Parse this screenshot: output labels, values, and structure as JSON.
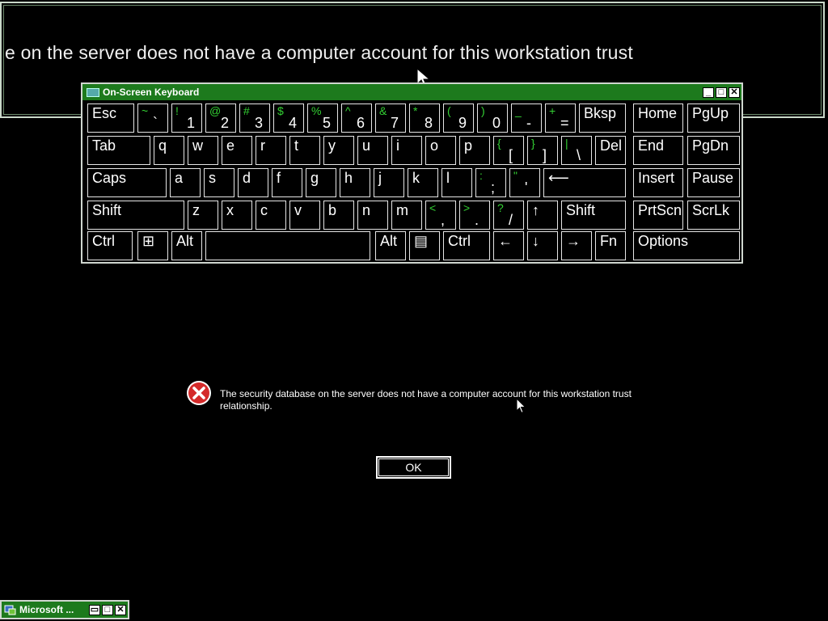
{
  "magnifier": {
    "text": "e on the server does not have a computer account for this workstation trust"
  },
  "osk": {
    "title": "On-Screen Keyboard",
    "controls": {
      "minimize": "_",
      "maximize": "□",
      "close": "✕"
    },
    "keys": [
      {
        "id": "esc",
        "label": "Esc"
      },
      {
        "id": "grave",
        "shift": "~",
        "base": "`"
      },
      {
        "id": "1",
        "shift": "!",
        "base": "1"
      },
      {
        "id": "2",
        "shift": "@",
        "base": "2"
      },
      {
        "id": "3",
        "shift": "#",
        "base": "3"
      },
      {
        "id": "4",
        "shift": "$",
        "base": "4"
      },
      {
        "id": "5",
        "shift": "%",
        "base": "5"
      },
      {
        "id": "6",
        "shift": "^",
        "base": "6"
      },
      {
        "id": "7",
        "shift": "&",
        "base": "7"
      },
      {
        "id": "8",
        "shift": "*",
        "base": "8"
      },
      {
        "id": "9",
        "shift": "(",
        "base": "9"
      },
      {
        "id": "0",
        "shift": ")",
        "base": "0"
      },
      {
        "id": "minus",
        "shift": "_",
        "base": "-"
      },
      {
        "id": "equals",
        "shift": "+",
        "base": "="
      },
      {
        "id": "bksp",
        "label": "Bksp"
      },
      {
        "id": "home",
        "label": "Home"
      },
      {
        "id": "pgup",
        "label": "PgUp"
      },
      {
        "id": "tab",
        "label": "Tab"
      },
      {
        "id": "q",
        "label": "q"
      },
      {
        "id": "w",
        "label": "w"
      },
      {
        "id": "e",
        "label": "e"
      },
      {
        "id": "r",
        "label": "r"
      },
      {
        "id": "t",
        "label": "t"
      },
      {
        "id": "y",
        "label": "y"
      },
      {
        "id": "u",
        "label": "u"
      },
      {
        "id": "i",
        "label": "i"
      },
      {
        "id": "o",
        "label": "o"
      },
      {
        "id": "p",
        "label": "p"
      },
      {
        "id": "lbracket",
        "shift": "{",
        "base": "["
      },
      {
        "id": "rbracket",
        "shift": "}",
        "base": "]"
      },
      {
        "id": "backslash",
        "shift": "|",
        "base": "\\"
      },
      {
        "id": "del",
        "label": "Del"
      },
      {
        "id": "end",
        "label": "End"
      },
      {
        "id": "pgdn",
        "label": "PgDn"
      },
      {
        "id": "caps",
        "label": "Caps"
      },
      {
        "id": "a",
        "label": "a"
      },
      {
        "id": "s",
        "label": "s"
      },
      {
        "id": "d",
        "label": "d"
      },
      {
        "id": "f",
        "label": "f"
      },
      {
        "id": "g",
        "label": "g"
      },
      {
        "id": "h",
        "label": "h"
      },
      {
        "id": "j",
        "label": "j"
      },
      {
        "id": "k",
        "label": "k"
      },
      {
        "id": "l",
        "label": "l"
      },
      {
        "id": "semicolon",
        "shift": ":",
        "base": ";"
      },
      {
        "id": "quote",
        "shift": "\"",
        "base": "'"
      },
      {
        "id": "enter",
        "label": "⟵"
      },
      {
        "id": "insert",
        "label": "Insert"
      },
      {
        "id": "pause",
        "label": "Pause"
      },
      {
        "id": "lshift",
        "label": "Shift"
      },
      {
        "id": "z",
        "label": "z"
      },
      {
        "id": "x",
        "label": "x"
      },
      {
        "id": "c",
        "label": "c"
      },
      {
        "id": "v",
        "label": "v"
      },
      {
        "id": "b",
        "label": "b"
      },
      {
        "id": "n",
        "label": "n"
      },
      {
        "id": "m",
        "label": "m"
      },
      {
        "id": "comma",
        "shift": "<",
        "base": ","
      },
      {
        "id": "period",
        "shift": ">",
        "base": "."
      },
      {
        "id": "slash",
        "shift": "?",
        "base": "/"
      },
      {
        "id": "up",
        "label": "↑"
      },
      {
        "id": "rshift",
        "label": "Shift"
      },
      {
        "id": "prtscn",
        "label": "PrtScn"
      },
      {
        "id": "scrlk",
        "label": "ScrLk"
      },
      {
        "id": "lctrl",
        "label": "Ctrl"
      },
      {
        "id": "win",
        "label": "⊞"
      },
      {
        "id": "lalt",
        "label": "Alt"
      },
      {
        "id": "space",
        "label": ""
      },
      {
        "id": "ralt",
        "label": "Alt"
      },
      {
        "id": "menu",
        "label": "▤"
      },
      {
        "id": "rctrl",
        "label": "Ctrl"
      },
      {
        "id": "left",
        "label": "←"
      },
      {
        "id": "down",
        "label": "↓"
      },
      {
        "id": "right",
        "label": "→"
      },
      {
        "id": "fn",
        "label": "Fn"
      },
      {
        "id": "options",
        "label": "Options"
      }
    ]
  },
  "dialog": {
    "icon": "error-icon",
    "message": "The security database on the server does not have a computer account for this workstation trust relationship.",
    "ok_label": "OK"
  },
  "taskbar": {
    "label": "Microsoft ...",
    "controls": {
      "restore": "▭",
      "maximize": "□",
      "close": "✕"
    }
  },
  "colors": {
    "accent": "#1d7a1d",
    "shift_text": "#33d033",
    "background": "#000000"
  }
}
